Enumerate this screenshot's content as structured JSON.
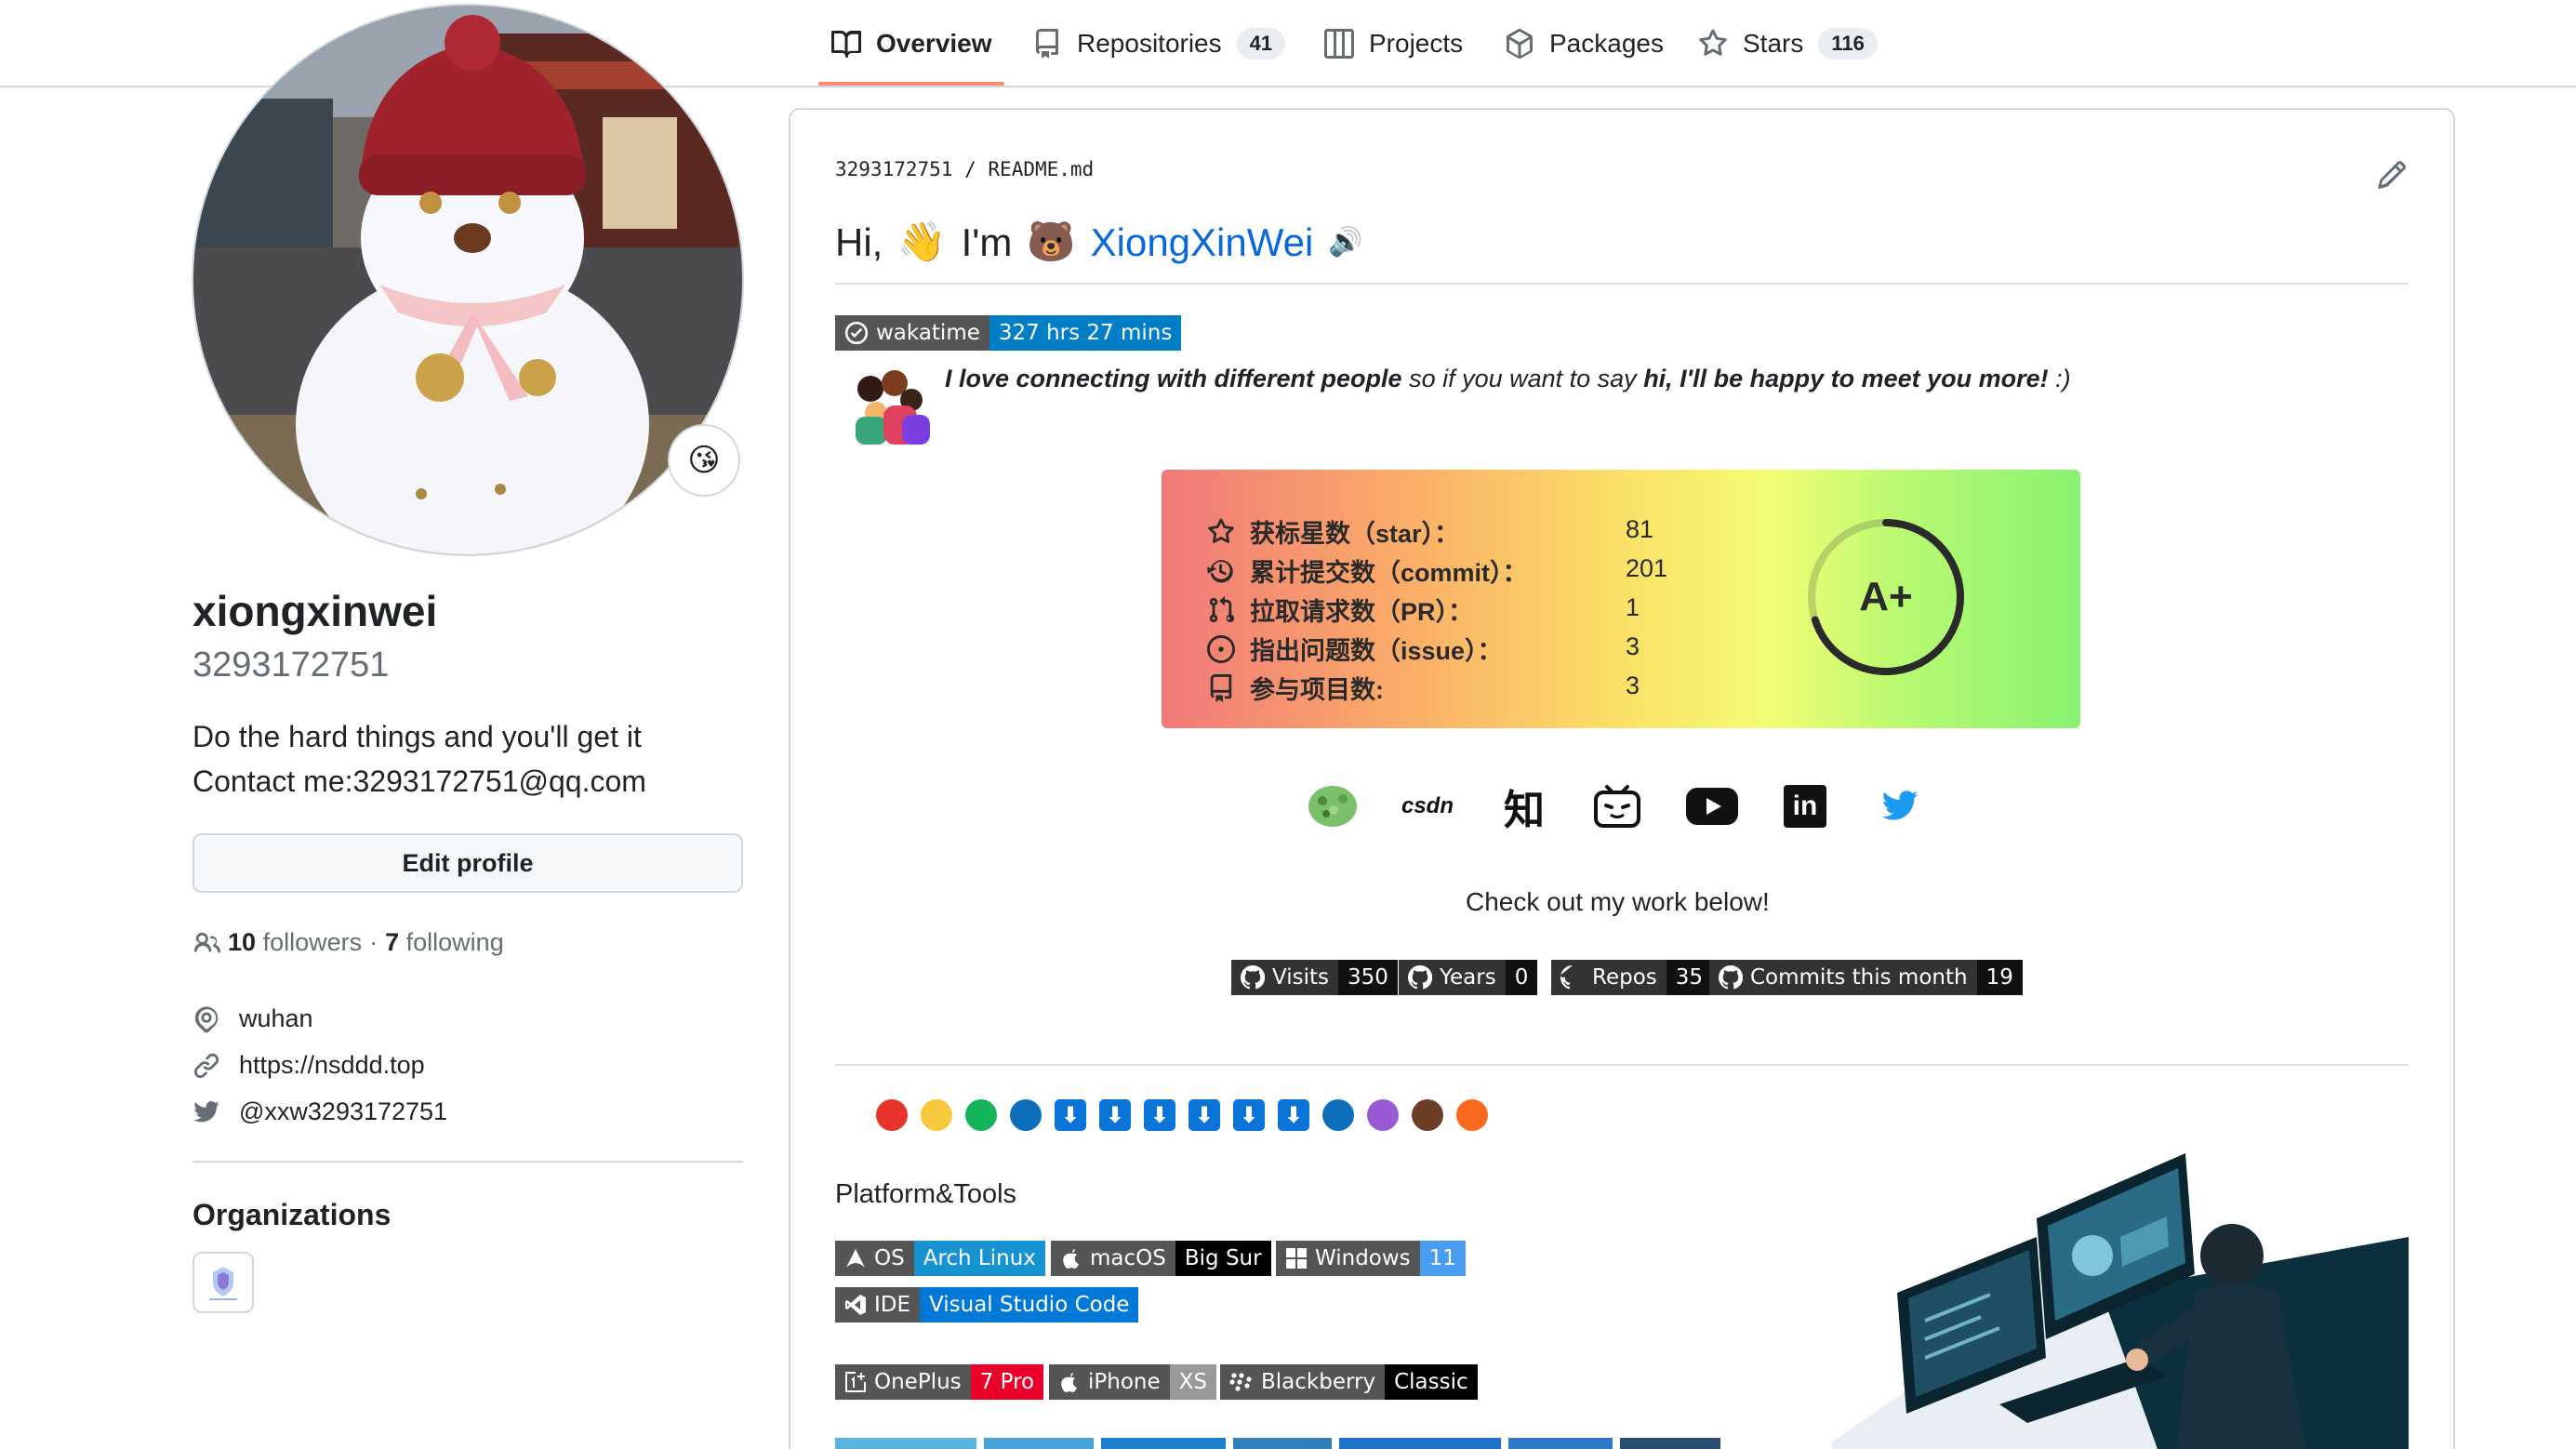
{
  "nav": {
    "tabs": [
      {
        "label": "Overview",
        "icon": "book-icon",
        "count": null
      },
      {
        "label": "Repositories",
        "icon": "repo-icon",
        "count": "41"
      },
      {
        "label": "Projects",
        "icon": "project-icon",
        "count": null
      },
      {
        "label": "Packages",
        "icon": "package-icon",
        "count": null
      },
      {
        "label": "Stars",
        "icon": "star-icon",
        "count": "116"
      }
    ],
    "active": "Overview",
    "underline_color": "#fd8c73"
  },
  "profile": {
    "display_name": "xiongxinwei",
    "username": "3293172751",
    "status_emoji": "😘",
    "bio_line1": "Do the hard things and you'll get it",
    "bio_line2": "Contact me:3293172751@qq.com",
    "edit_label": "Edit profile",
    "followers_count": "10",
    "followers_label": "followers",
    "dot": "·",
    "following_count": "7",
    "following_label": "following",
    "location": "wuhan",
    "website": "https://nsddd.top",
    "twitter": "@xxw3293172751",
    "organizations_title": "Organizations"
  },
  "readme": {
    "path_user": "3293172751",
    "path_sep": "/",
    "path_file": "README.md",
    "hi_prefix": "Hi,",
    "wave": "👋",
    "im": "I'm",
    "bear": "🐻",
    "name": "XiongXinWei",
    "speaker": "🔊",
    "wakatime_label": "wakatime",
    "wakatime_value": "327 hrs 27 mins",
    "intro_a": "I love connecting with different people",
    "intro_b": " so if you want to say ",
    "intro_c": "hi, I'll be happy to meet you more!",
    "intro_d": " :)",
    "stats": [
      {
        "icon": "star-icon",
        "label": "获标星数（star）：",
        "value": "81"
      },
      {
        "icon": "history-icon",
        "label": "累计提交数（commit）：",
        "value": "201"
      },
      {
        "icon": "pull-request-icon",
        "label": "拉取请求数（PR）：",
        "value": "1"
      },
      {
        "icon": "issue-icon",
        "label": "指出问题数（issue）：",
        "value": "3"
      },
      {
        "icon": "repo-icon",
        "label": "参与项目数:",
        "value": "3"
      }
    ],
    "grade": "A+",
    "grade_fraction": 0.7,
    "social_icons": [
      "wechat-icon",
      "csdn-icon",
      "zhihu-icon",
      "bilibili-icon",
      "youtube-icon",
      "linkedin-icon",
      "twitter-icon"
    ],
    "csdn_text": "csdn",
    "zhihu_text": "知",
    "linkedin_text": "in",
    "work_below": "Check out my work below!",
    "counters": [
      {
        "label": "Visits",
        "value": "350"
      },
      {
        "label": "Years",
        "value": "0"
      },
      {
        "label": "Repos",
        "value": "35"
      },
      {
        "label": "Commits this month",
        "value": "19"
      }
    ],
    "dots": [
      "#e8322c",
      "#f6c83b",
      "#13b55b",
      "#0b6fbe",
      "DL",
      "DL",
      "DL",
      "DL",
      "DL",
      "DL",
      "#0b6fbe",
      "#9b59d4",
      "#6b3e25",
      "#fa6a1c"
    ],
    "download_glyph": "⬇",
    "platform_title": "Platform&Tools",
    "platform_badges": [
      {
        "label": "OS",
        "value": "Arch Linux",
        "color": "#1793d1"
      },
      {
        "label": "macOS",
        "value": "Big Sur",
        "color": "#000000"
      },
      {
        "label": "Windows",
        "value": "11",
        "color": "#4a9cf0"
      },
      {
        "label": "IDE",
        "value": "Visual Studio Code",
        "color": "#0078d6"
      },
      {
        "label": "OnePlus",
        "value": "7 Pro",
        "color": "#eb0029"
      },
      {
        "label": "iPhone",
        "value": "XS",
        "color": "#999999"
      },
      {
        "label": "Blackberry",
        "value": "Classic",
        "color": "#000000"
      }
    ]
  }
}
